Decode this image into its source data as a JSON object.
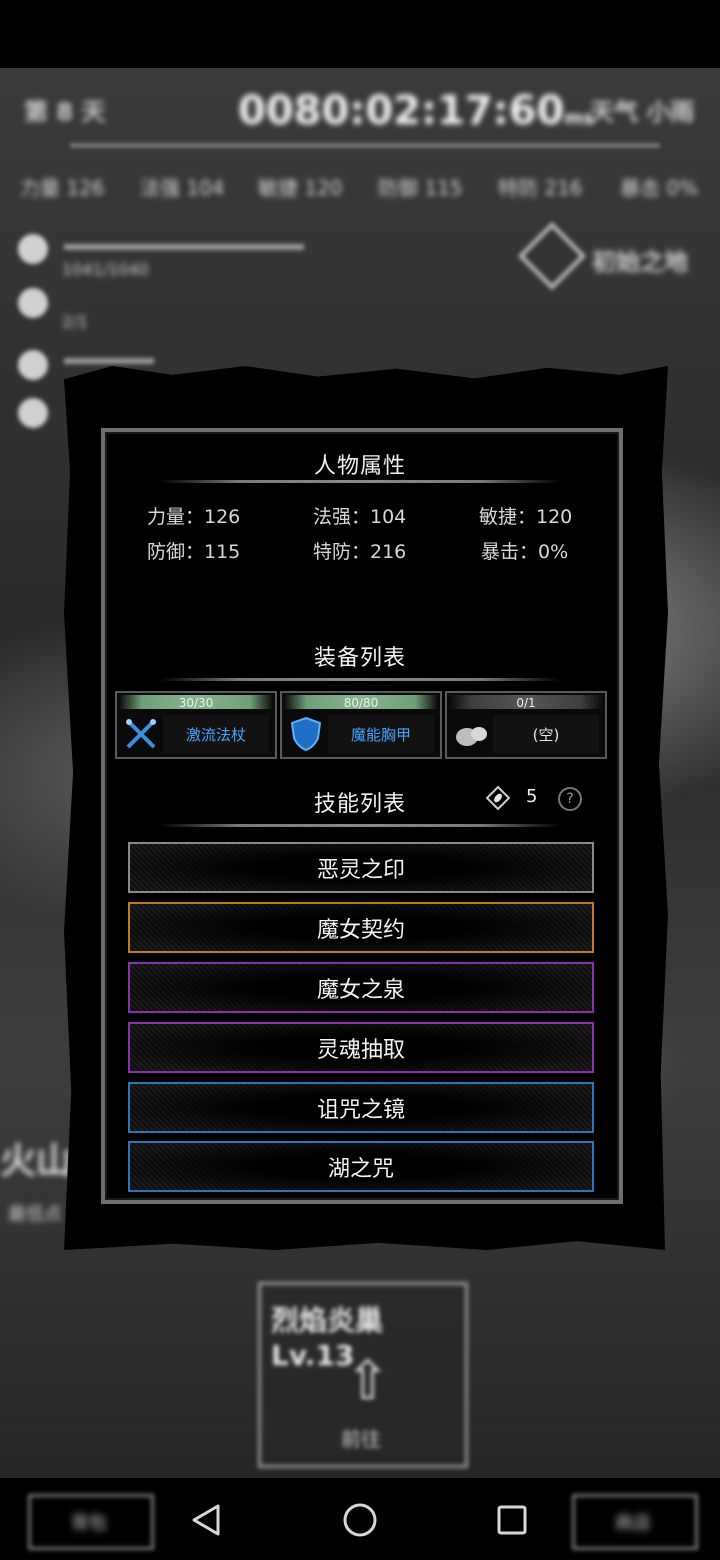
{
  "background": {
    "day_label": "第 8 天",
    "timer": "0080:02:17:60",
    "timer_unit": "ms",
    "weather": "天气 小雨",
    "stats": [
      "力量 126",
      "法强 104",
      "敏捷 120",
      "防御 115",
      "特防 216",
      "暴击 0%"
    ],
    "hp_text": "1041/1040",
    "stamina_text": "2/1",
    "map_label": "初始之地",
    "location": "火山",
    "location_sub": "最低点",
    "level_card": {
      "title": "烈焰炎巢 Lv.13",
      "action": "前往"
    },
    "bottom_buttons": [
      "背包",
      "商店"
    ]
  },
  "panel": {
    "attributes_title": "人物属性",
    "attributes": [
      {
        "label": "力量：126"
      },
      {
        "label": "法强：104"
      },
      {
        "label": "敏捷：120"
      },
      {
        "label": "防御：115"
      },
      {
        "label": "特防：216"
      },
      {
        "label": "暴击：0%"
      }
    ],
    "equipment_title": "装备列表",
    "equipment": [
      {
        "durability": "30/30",
        "name": "激流法杖",
        "icon": "crossed-staffs-icon",
        "durability_fraction": 1.0
      },
      {
        "durability": "80/80",
        "name": "魔能胸甲",
        "icon": "shield-armor-icon",
        "durability_fraction": 1.0
      },
      {
        "durability": "0/1",
        "name": "(空)",
        "icon": "empty-slot-icon",
        "durability_fraction": 0.0
      }
    ],
    "skills_title": "技能列表",
    "skill_points": "5",
    "help_label": "?",
    "skills": [
      {
        "name": "恶灵之印",
        "color": "#8a8a8a"
      },
      {
        "name": "魔女契约",
        "color": "#c27a1e"
      },
      {
        "name": "魔女之泉",
        "color": "#8a2fb0"
      },
      {
        "name": "灵魂抽取",
        "color": "#8a2fb0"
      },
      {
        "name": "诅咒之镜",
        "color": "#2f74b8"
      },
      {
        "name": "湖之咒",
        "color": "#2f74b8"
      }
    ]
  },
  "colors": {
    "accent_blue": "#4aa3ff",
    "durability_green": "#86b48e"
  }
}
